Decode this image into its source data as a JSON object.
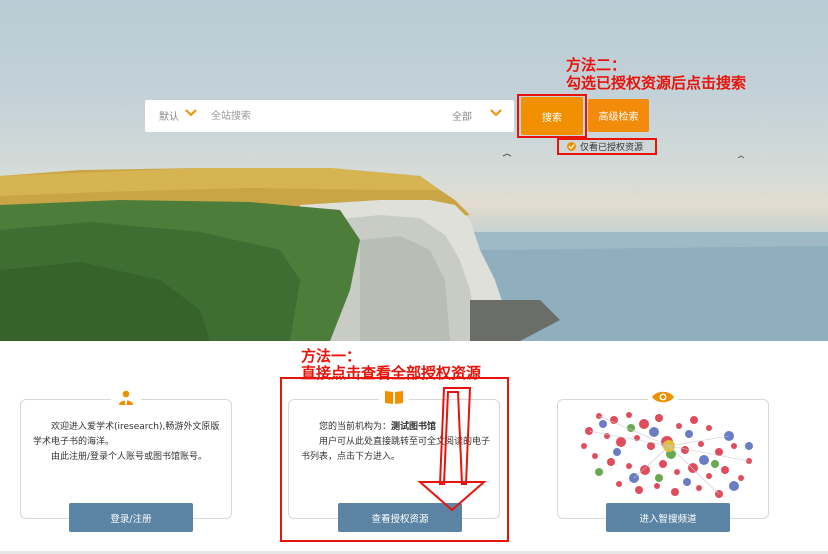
{
  "search": {
    "scope": "默认",
    "placeholder": "全站搜索",
    "type": "全部",
    "search_button": "搜索",
    "advanced_button": "高级检索",
    "auth_only_label": "仅看已授权资源"
  },
  "annotations": {
    "method2_line1": "方法二：",
    "method2_line2": "勾选已授权资源后点击搜索",
    "method1_line1": "方法一：",
    "method1_line2": "直接点击查看全部授权资源"
  },
  "cards": {
    "login": {
      "text1": "欢迎进入爱学术(iresearch),畅游外文原版学术电子书的海洋。",
      "text2": "由此注册/登录个人账号或图书馆账号。",
      "button": "登录/注册"
    },
    "institution": {
      "label": "您的当前机构为：",
      "name": "测试图书馆",
      "text": "用户可从此处直接跳转至可全文阅读的电子书列表，点击下方进入。",
      "button": "查看授权资源"
    },
    "smart": {
      "button": "进入智搜频道"
    }
  },
  "colors": {
    "accent": "#f08f00",
    "annotation": "#e8140c",
    "card_button": "#5b84a4"
  },
  "icons": {
    "chevron": "chevron-down-icon",
    "check": "check-circle-icon",
    "user": "user-icon",
    "book": "book-icon",
    "eye": "eye-icon"
  }
}
